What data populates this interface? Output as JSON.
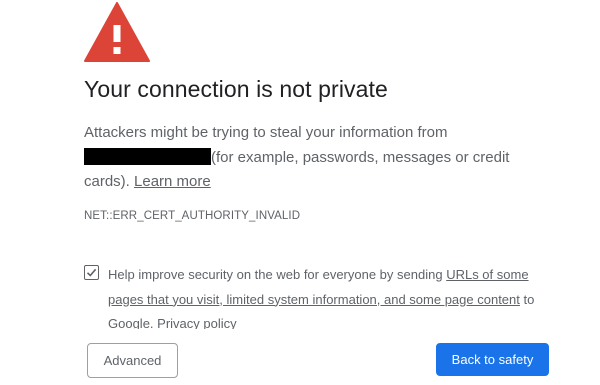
{
  "colors": {
    "warning_red": "#db4437",
    "primary_blue": "#1a73e8",
    "text_primary": "#202124",
    "text_secondary": "#5f6368"
  },
  "icon": "warning-triangle-icon",
  "title": "Your connection is not private",
  "body": {
    "line1": "Attackers might be trying to steal your information from",
    "after_redacted": "(for example, passwords, messages or credit",
    "line3_start": "cards). ",
    "learn_more": "Learn more"
  },
  "error_code": "NET::ERR_CERT_AUTHORITY_INVALID",
  "optin": {
    "checked": true,
    "text_before": "Help improve security on the web for everyone by sending ",
    "link_text": "URLs of some pages that you visit, limited system information, and some page content",
    "text_after": " to Google. ",
    "privacy_link": "Privacy policy"
  },
  "buttons": {
    "advanced": "Advanced",
    "back_to_safety": "Back to safety"
  }
}
